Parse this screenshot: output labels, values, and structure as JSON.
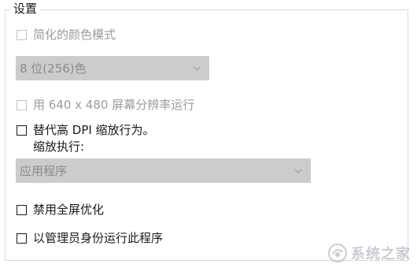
{
  "group": {
    "title": "设置"
  },
  "options": {
    "reduced_color": {
      "label": "简化的颜色模式",
      "checked": false,
      "enabled": false
    },
    "color_select": {
      "value": "8 位(256)色",
      "enabled": false
    },
    "res_640": {
      "label": "用 640 x 480 屏幕分辨率运行",
      "checked": false,
      "enabled": false
    },
    "dpi_override": {
      "label": "替代高 DPI 缩放行为。",
      "sublabel": "缩放执行:",
      "checked": false,
      "enabled": true
    },
    "dpi_select": {
      "value": "应用程序",
      "enabled": false
    },
    "disable_fullscreen": {
      "label": "禁用全屏优化",
      "checked": false,
      "enabled": true
    },
    "run_as_admin": {
      "label": "以管理员身份运行此程序",
      "checked": false,
      "enabled": true
    }
  },
  "watermark": {
    "text": "系统之家",
    "icon": "system-logo-icon"
  }
}
